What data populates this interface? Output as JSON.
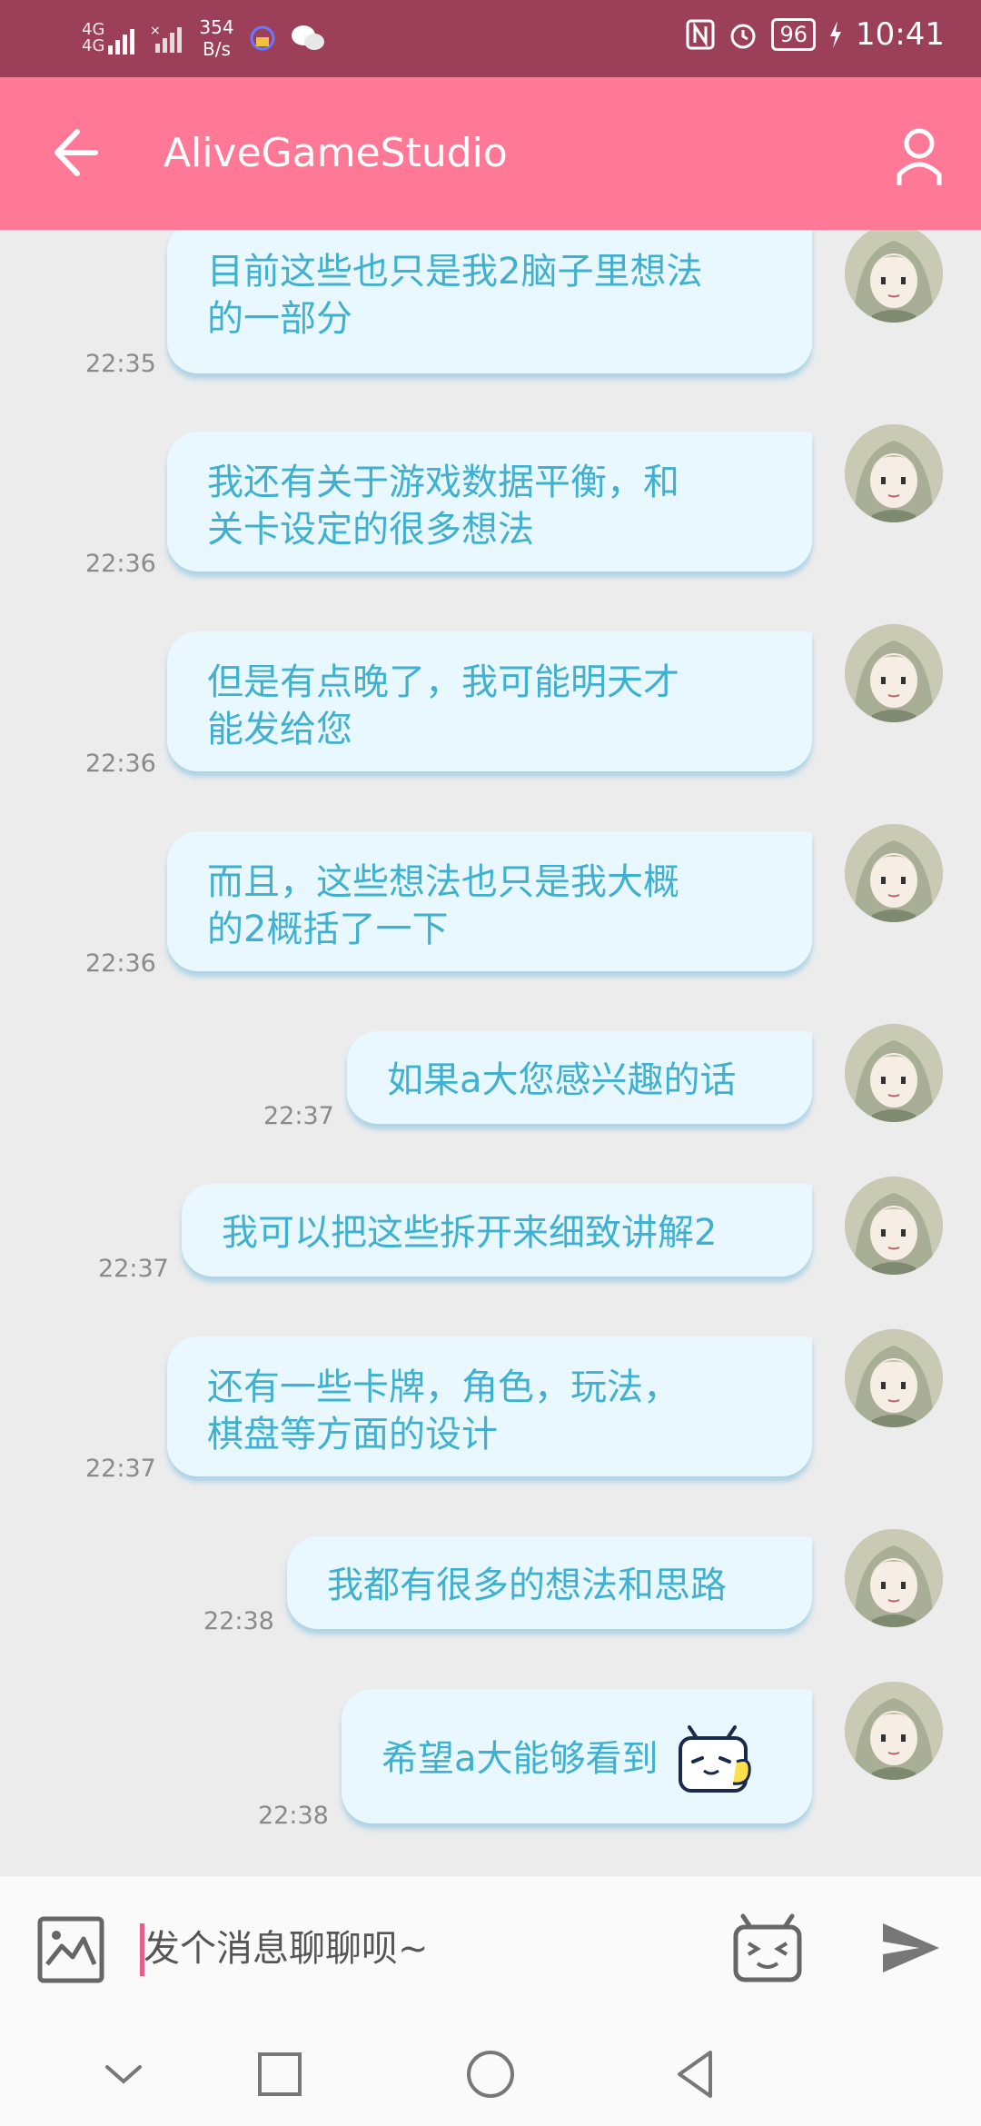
{
  "status_bar": {
    "network_top": "4G",
    "network_bottom": "4G",
    "net_speed_value": "354",
    "net_speed_unit": "B/s",
    "battery": "96",
    "time": "10:41"
  },
  "header": {
    "title": "AliveGameStudio",
    "back_icon": "arrow-left-icon",
    "profile_icon": "user-icon"
  },
  "messages": [
    {
      "text": "目前这些也只是我2脑子里想法的一部分",
      "line1": "目前这些也只是我2脑子里想法",
      "line2": "的一部分",
      "time": "22:35"
    },
    {
      "text": "我还有关于游戏数据平衡，和关卡设定的很多想法",
      "line1": "我还有关于游戏数据平衡，和",
      "line2": "关卡设定的很多想法",
      "time": "22:36"
    },
    {
      "text": "但是有点晚了，我可能明天才能发给您",
      "line1": "但是有点晚了，我可能明天才",
      "line2": "能发给您",
      "time": "22:36"
    },
    {
      "text": "而且，这些想法也只是我大概的2概括了一下",
      "line1": "而且，这些想法也只是我大概",
      "line2": "的2概括了一下",
      "time": "22:36"
    },
    {
      "text": "如果a大您感兴趣的话",
      "time": "22:37"
    },
    {
      "text": "我可以把这些拆开来细致讲解2",
      "time": "22:37"
    },
    {
      "text": "还有一些卡牌，角色，玩法，棋盘等方面的设计",
      "line1": "还有一些卡牌，角色，玩法，",
      "line2": "棋盘等方面的设计",
      "time": "22:37"
    },
    {
      "text": "我都有很多的想法和思路",
      "time": "22:38"
    },
    {
      "text": "希望a大能够看到",
      "time": "22:38",
      "sticker": "thumbs-up-tv-sticker-icon"
    }
  ],
  "input": {
    "placeholder": "发个消息聊聊呗~",
    "image_icon": "image-icon",
    "emoji_icon": "emoji-tv-icon",
    "send_icon": "send-icon"
  },
  "nav_bar": [
    "chevron-down-icon",
    "square-icon",
    "circle-icon",
    "back-triangle-icon"
  ],
  "colors": {
    "status_bar": "#9b4058",
    "app_bar": "#ff7896",
    "chat_background": "#ececec",
    "bubble": "#e9f8ff",
    "bubble_text": "#3fb0cf",
    "cursor": "#e56088"
  }
}
